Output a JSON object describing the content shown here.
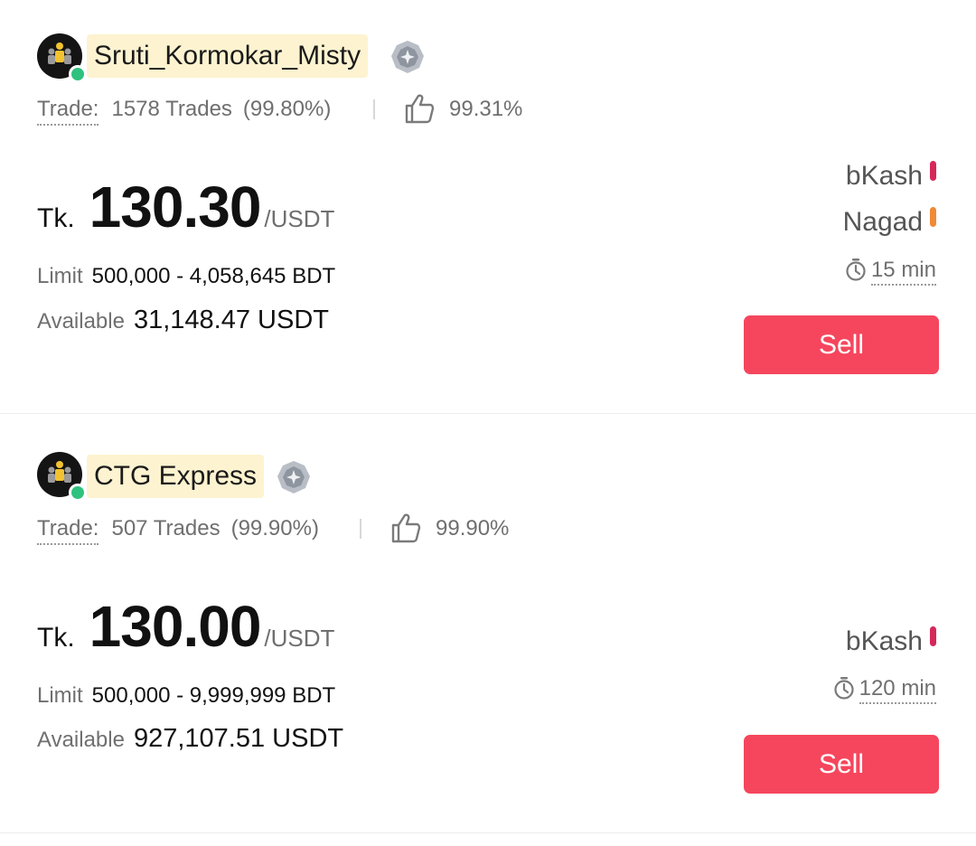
{
  "listings": [
    {
      "merchant": "Sruti_Kormokar_Misty",
      "trade_label": "Trade:",
      "trades": "1578 Trades",
      "completion": "(99.80%)",
      "positive_rate": "99.31%",
      "currency": "Tk.",
      "price": "130.30",
      "unit": "/USDT",
      "limit_label": "Limit",
      "limit": "500,000 - 4,058,645 BDT",
      "available_label": "Available",
      "available": "31,148.47 USDT",
      "payments": [
        {
          "name": "bKash",
          "color": "#d6275a"
        },
        {
          "name": "Nagad",
          "color": "#f08a36"
        }
      ],
      "time_limit": "15 min",
      "action": "Sell"
    },
    {
      "merchant": "CTG Express",
      "trade_label": "Trade:",
      "trades": "507 Trades",
      "completion": "(99.90%)",
      "positive_rate": "99.90%",
      "currency": "Tk.",
      "price": "130.00",
      "unit": "/USDT",
      "limit_label": "Limit",
      "limit": "500,000 - 9,999,999 BDT",
      "available_label": "Available",
      "available": "927,107.51 USDT",
      "payments": [
        {
          "name": "bKash",
          "color": "#d6275a"
        }
      ],
      "time_limit": "120 min",
      "action": "Sell"
    }
  ],
  "colors": {
    "sell_button": "#f5465d",
    "name_highlight": "#fdf3d0",
    "online_status": "#2ec27e"
  },
  "icons": {
    "avatar": "avatar-icon",
    "badge": "merchant-badge-icon",
    "thumb": "thumbs-up-icon",
    "clock": "timer-icon"
  }
}
